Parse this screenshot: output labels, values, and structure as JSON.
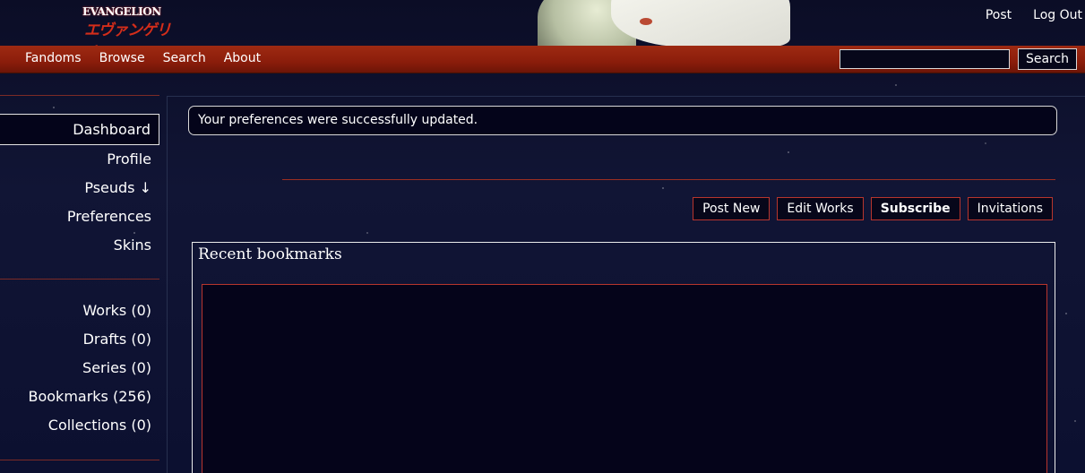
{
  "header": {
    "logo_top": "EVANGELION",
    "logo_bottom": "エヴァンゲリオン",
    "top_links": [
      "Post",
      "Log Out"
    ]
  },
  "nav": {
    "items": [
      "Fandoms",
      "Browse",
      "Search",
      "About"
    ],
    "search_button": "Search",
    "search_value": ""
  },
  "sidebar": {
    "items": [
      {
        "label": "Dashboard"
      },
      {
        "label": "Profile"
      },
      {
        "label": "Pseuds ↓"
      },
      {
        "label": "Preferences"
      },
      {
        "label": "Skins"
      }
    ],
    "stats": [
      {
        "label": "Works (0)"
      },
      {
        "label": "Drafts (0)"
      },
      {
        "label": "Series (0)"
      },
      {
        "label": "Bookmarks (256)"
      },
      {
        "label": "Collections (0)"
      }
    ]
  },
  "main": {
    "flash": "Your preferences were successfully updated.",
    "actions": [
      "Post New",
      "Edit Works",
      "Subscribe",
      "Invitations"
    ],
    "bookmarks_title": "Recent bookmarks"
  },
  "colors": {
    "nav_red": "#8b1d0b",
    "accent_border": "#b8352d",
    "background": "#0d0f2a"
  }
}
